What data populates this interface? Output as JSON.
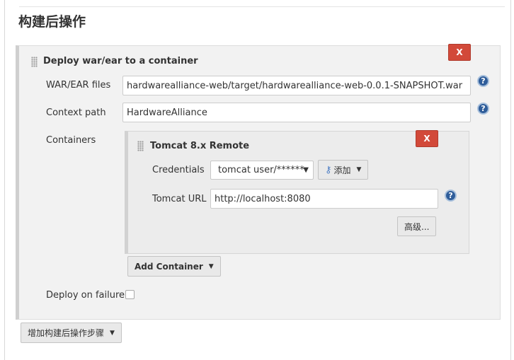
{
  "section": {
    "title": "构建后操作"
  },
  "step": {
    "title": "Deploy war/ear to a container",
    "delete_label": "X",
    "fields": {
      "war_files": {
        "label": "WAR/EAR files",
        "value": "hardwarealliance-web/target/hardwarealliance-web-0.0.1-SNAPSHOT.war"
      },
      "context_path": {
        "label": "Context path",
        "value": "HardwareAlliance"
      },
      "containers_label": "Containers",
      "deploy_on_failure": {
        "label": "Deploy on failure",
        "checked": false
      }
    },
    "container": {
      "title": "Tomcat 8.x Remote",
      "delete_label": "X",
      "credentials": {
        "label": "Credentials",
        "selected": "tomcat  user/******",
        "add_label": "添加"
      },
      "tomcat_url": {
        "label": "Tomcat URL",
        "value": "http://localhost:8080"
      },
      "advanced_label": "高级..."
    },
    "add_container_label": "Add Container"
  },
  "add_step_label": "增加构建后操作步骤",
  "help_glyph": "?",
  "icons": [
    "drag-handle-icon",
    "help-icon",
    "key-icon",
    "chevron-down-icon"
  ]
}
